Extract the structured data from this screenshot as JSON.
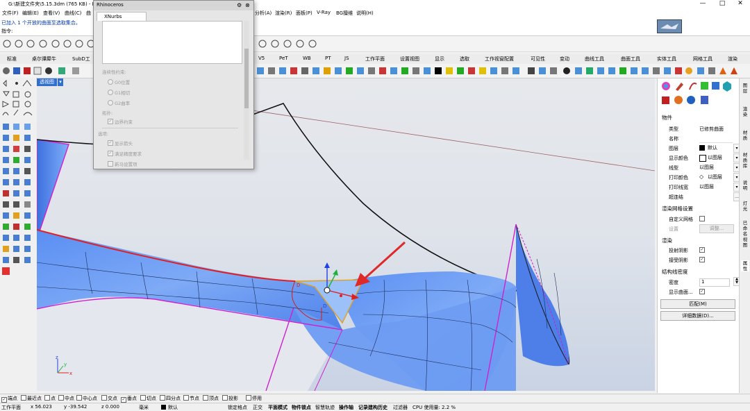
{
  "window": {
    "title": "G:\\新建文件夹\\5.15.3dm (765 KB) - Rh",
    "controls": [
      "—",
      "□",
      "✕"
    ]
  },
  "menu": [
    "文件(F)",
    "编辑(E)",
    "查看(V)",
    "曲线(C)",
    "曲",
    "分析(A)",
    "渲染(R)",
    "面板(P)",
    "V-Ray",
    "BG擅维",
    "说明(H)"
  ],
  "command": {
    "history": "已加入 1 个开放的曲面至选取集合。",
    "prompt": "指令:"
  },
  "toolbar_tabs": [
    "标准",
    "桌尔谭犀牛",
    "SubD工",
    "V5",
    "PeT",
    "WB",
    "PT",
    "JS",
    "工作平面",
    "设置视图",
    "显示",
    "选取",
    "工作视窗配置",
    "可见性",
    "变动",
    "曲线工具",
    "曲面工具",
    "实体工具",
    "网格工具",
    "渲染"
  ],
  "viewport": {
    "label": "透视图",
    "caret": "▾",
    "axes": {
      "x": "x",
      "y": "y",
      "z": "z"
    }
  },
  "dialog": {
    "title": "Rhinoceros",
    "tab": "XNurbs",
    "continuity_label": "连续性约束:",
    "options": [
      "G0位置",
      "G1相切",
      "G2曲率"
    ],
    "align_label": "拓扑:",
    "boundary": "边界约束",
    "opts_label": "选项:",
    "checks": [
      "显示箭头",
      "满足精度要求",
      "新马设置项"
    ]
  },
  "properties": {
    "section_object": "物件",
    "rows": [
      {
        "label": "类型",
        "value": "已修剪曲面"
      },
      {
        "label": "名称",
        "value": ""
      },
      {
        "label": "图层",
        "value": "默认"
      },
      {
        "label": "显示颜色",
        "value": "以图层"
      },
      {
        "label": "线型",
        "value": "以图层"
      },
      {
        "label": "打印颜色",
        "value": "以图层"
      },
      {
        "label": "打印线宽",
        "value": "以图层"
      },
      {
        "label": "超连结",
        "value": ""
      }
    ],
    "section_mesh": "渲染网格设置",
    "custom_mesh": "自定义网格",
    "settings_label": "设置",
    "adjust_btn": "调整...",
    "section_render": "渲染",
    "cast_shadows": "投射阴影",
    "receive_shadows": "接受阴影",
    "section_iso": "结构线密度",
    "density_label": "密度",
    "density_value": "1",
    "show_iso": "显示曲面...",
    "match_btn": "匹配(M)",
    "details_btn": "详细数据(D)..."
  },
  "right_tabs": [
    "图层",
    "渲染",
    "材质",
    "材质库",
    "说明",
    "灯光",
    "已命名视图",
    "属性"
  ],
  "osnap": [
    {
      "label": "端点",
      "on": true
    },
    {
      "label": "最近点",
      "on": false
    },
    {
      "label": "点",
      "on": false
    },
    {
      "label": "中点",
      "on": false
    },
    {
      "label": "中心点",
      "on": false
    },
    {
      "label": "交点",
      "on": false
    },
    {
      "label": "垂点",
      "on": true
    },
    {
      "label": "切点",
      "on": false
    },
    {
      "label": "四分点",
      "on": false
    },
    {
      "label": "节点",
      "on": false
    },
    {
      "label": "顶点",
      "on": false
    },
    {
      "label": "投影",
      "on": false
    },
    {
      "label": "停用",
      "on": false
    }
  ],
  "status": {
    "cplane": "工作平面",
    "x": "x 56.023",
    "y": "y -39.542",
    "z": "z 0.000",
    "unit": "毫米",
    "layer": "默认",
    "toggles": [
      "锁定格点",
      "正交",
      "平面模式",
      "物件锁点",
      "智慧轨迹",
      "操作轴",
      "记录建构历史",
      "过滤器"
    ],
    "cpu": "CPU 使用量: 2.2 %"
  },
  "colors": {
    "surface": "#5c8ef0",
    "edge_magenta": "#d020d0",
    "edge_red": "#e02020",
    "accent_tab": "#2f6fd0",
    "arrow_red": "#e02828"
  }
}
